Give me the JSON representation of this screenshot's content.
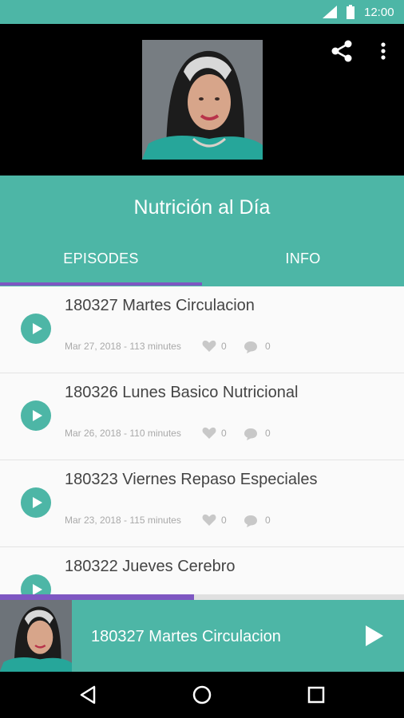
{
  "status_bar": {
    "time": "12:00"
  },
  "podcast": {
    "title": "Nutrición al Día"
  },
  "tabs": [
    {
      "label": "EPISODES",
      "selected": true
    },
    {
      "label": "INFO",
      "selected": false
    }
  ],
  "episodes": [
    {
      "title": "180327 Martes Circulacion",
      "meta": "Mar 27, 2018 - 113 minutes",
      "likes": "0",
      "comments": "0"
    },
    {
      "title": "180326 Lunes Basico Nutricional",
      "meta": "Mar 26, 2018 - 110 minutes",
      "likes": "0",
      "comments": "0"
    },
    {
      "title": "180323 Viernes Repaso Especiales",
      "meta": "Mar 23, 2018 - 115 minutes",
      "likes": "0",
      "comments": "0"
    },
    {
      "title": "180322 Jueves Cerebro"
    }
  ],
  "player": {
    "title": "180327 Martes Circulacion",
    "progress": 0.48
  },
  "colors": {
    "accent": "#4db6a6",
    "indicator": "#7e57c2"
  },
  "icons": [
    "signal-icon",
    "battery-icon",
    "share-icon",
    "more-vert-icon",
    "play-icon",
    "heart-icon",
    "comment-icon",
    "back-icon",
    "home-icon",
    "recents-icon"
  ]
}
